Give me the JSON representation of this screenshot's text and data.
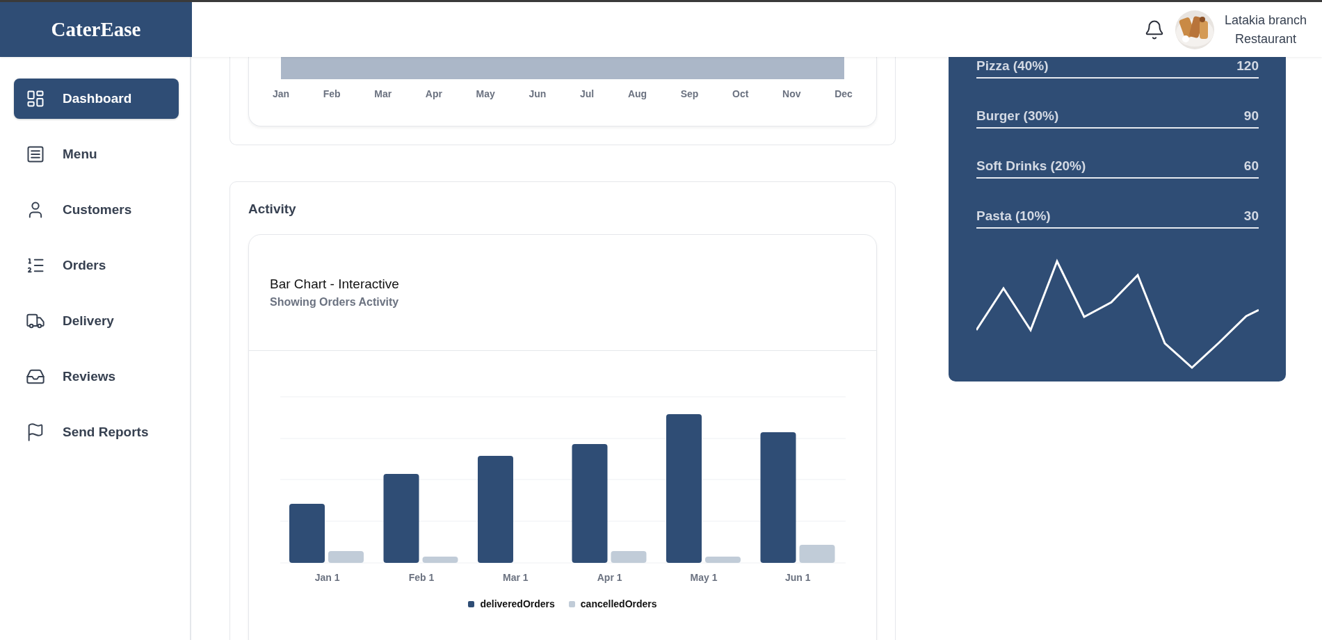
{
  "brand": {
    "name": "CaterEase"
  },
  "header": {
    "account": {
      "name": "Latakia branch",
      "role": "Restaurant"
    }
  },
  "sidebar": {
    "items": [
      {
        "label": "Dashboard",
        "selected": true
      },
      {
        "label": "Menu",
        "selected": false
      },
      {
        "label": "Customers",
        "selected": false
      },
      {
        "label": "Orders",
        "selected": false
      },
      {
        "label": "Delivery",
        "selected": false
      },
      {
        "label": "Reviews",
        "selected": false
      },
      {
        "label": "Send Reports",
        "selected": false
      }
    ]
  },
  "monthly_chart": {
    "months": [
      "Jan",
      "Feb",
      "Mar",
      "Apr",
      "May",
      "Jun",
      "Jul",
      "Aug",
      "Sep",
      "Oct",
      "Nov",
      "Dec"
    ]
  },
  "activity": {
    "title": "Activity",
    "chart": {
      "title": "Bar Chart - Interactive",
      "subtitle": "Showing Orders Activity",
      "categories": [
        "Jan 1",
        "Feb 1",
        "Mar 1",
        "Apr 1",
        "May 1",
        "Jun 1"
      ],
      "legend": [
        {
          "name": "deliveredOrders",
          "color": "#2f4d75"
        },
        {
          "name": "cancelledOrders",
          "color": "#c1ccd8"
        }
      ]
    }
  },
  "top_items": [
    {
      "label": "Pizza (40%)",
      "value": "120"
    },
    {
      "label": "Burger (30%)",
      "value": "90"
    },
    {
      "label": "Soft Drinks (20%)",
      "value": "60"
    },
    {
      "label": "Pasta (10%)",
      "value": "30"
    }
  ]
}
